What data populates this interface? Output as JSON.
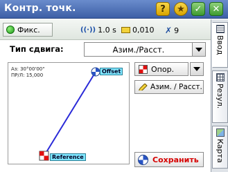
{
  "window": {
    "title": "Контр. точк.",
    "buttons": {
      "help": "?",
      "ok": "✓",
      "close": "✕"
    }
  },
  "status": {
    "fix_label": "Фикс.",
    "epoch": "1.0 s",
    "precision": "0,010",
    "satellites": "9"
  },
  "offset": {
    "label": "Тип сдвига:",
    "selected": "Азим./Расст."
  },
  "diagram": {
    "azimuth": "Аз: 30°00'00\"",
    "distance": "ПР/Л: 15,000",
    "offset_tag": "Offset",
    "reference_tag": "Reference",
    "line_color": "#2a2ad8"
  },
  "buttons": {
    "reference": "Опор.",
    "az_dist": "Азим. / Расст.",
    "save": "Сохранить"
  },
  "tabs": [
    {
      "label": "Ввод",
      "icon": "list-icon"
    },
    {
      "label": "Резул.",
      "icon": "grid-icon"
    },
    {
      "label": "Карта",
      "icon": "map-icon"
    }
  ],
  "colors": {
    "title_bg": "#3d5fa6",
    "save_text": "#d60000",
    "tag_bg": "#7fe6ff"
  }
}
